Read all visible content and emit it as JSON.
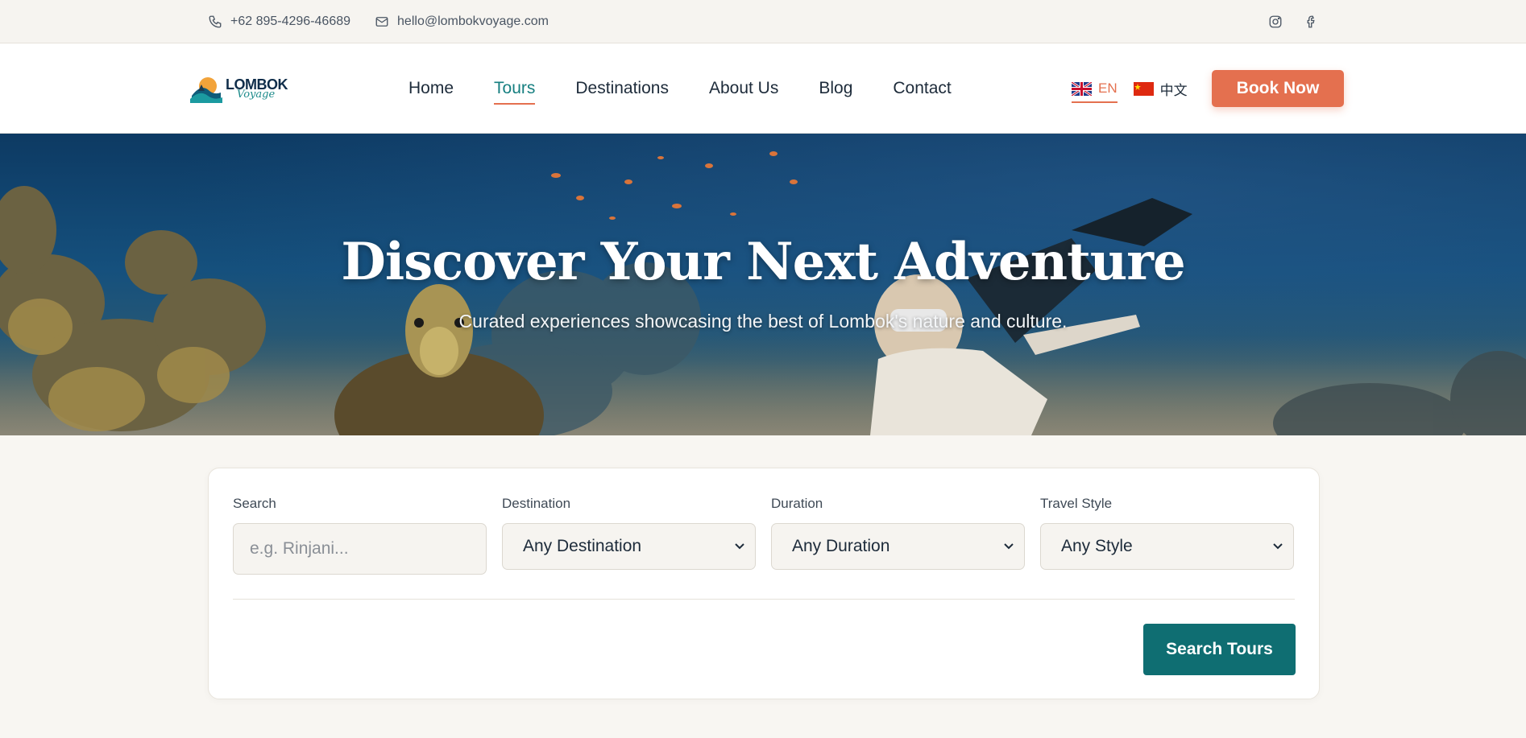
{
  "topbar": {
    "phone": "+62 895-4296-46689",
    "email": "hello@lombokvoyage.com",
    "social": [
      "instagram-icon",
      "facebook-icon"
    ]
  },
  "logo": {
    "word": "LOMBOK",
    "sub": "Voyage"
  },
  "nav": {
    "items": [
      {
        "label": "Home"
      },
      {
        "label": "Tours"
      },
      {
        "label": "Destinations"
      },
      {
        "label": "About Us"
      },
      {
        "label": "Blog"
      },
      {
        "label": "Contact"
      }
    ],
    "active": "Tours"
  },
  "languages": [
    {
      "label": "EN",
      "flag": "uk-flag-icon"
    },
    {
      "label": "中文",
      "flag": "china-flag-icon"
    }
  ],
  "book_button": "Book Now",
  "hero": {
    "title": "Discover Your Next Adventure",
    "subtitle": "Curated experiences showcasing the best of Lombok's nature and culture."
  },
  "search": {
    "search_label": "Search",
    "search_placeholder": "e.g. Rinjani...",
    "destination_label": "Destination",
    "destination_value": "Any Destination",
    "duration_label": "Duration",
    "duration_value": "Any Duration",
    "style_label": "Travel Style",
    "style_value": "Any Style",
    "submit": "Search Tours"
  },
  "colors": {
    "accent": "#e4704f",
    "teal": "#0f6e72",
    "nav_active": "#167f80"
  }
}
